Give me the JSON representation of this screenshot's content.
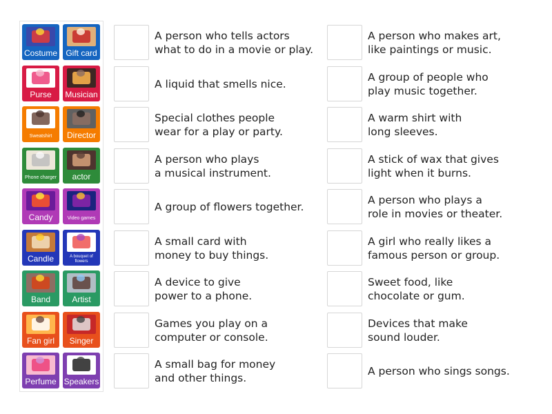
{
  "tiles": [
    {
      "label": "Costume",
      "color": "#1565c0",
      "pic": [
        "#3949ab",
        "#e53935",
        "#fdd835"
      ]
    },
    {
      "label": "Gift card",
      "color": "#1565c0",
      "pic": [
        "#e0b07a",
        "#c62828",
        "#fff3e0"
      ]
    },
    {
      "label": "Purse",
      "color": "#d81b45",
      "pic": [
        "#ffffff",
        "#ec407a",
        "#f8bbd0"
      ]
    },
    {
      "label": "Musician",
      "color": "#d81b45",
      "pic": [
        "#3e2723",
        "#ffb74d",
        "#8d6e63"
      ]
    },
    {
      "label": "Sweatshirt",
      "color": "#f57c00",
      "pic": [
        "#ffffff",
        "#6d4c41",
        "#4e342e"
      ],
      "small": true
    },
    {
      "label": "Director",
      "color": "#f57c00",
      "pic": [
        "#616161",
        "#8d6e63",
        "#212121"
      ]
    },
    {
      "label": "Phone charger",
      "color": "#2e8b3a",
      "pic": [
        "#ede7d9",
        "#bdbdbd",
        "#fafafa"
      ],
      "small": true
    },
    {
      "label": "actor",
      "color": "#2e8b3a",
      "pic": [
        "#4e342e",
        "#d7a27a",
        "#5d4037"
      ]
    },
    {
      "label": "Candy",
      "color": "#b03ab6",
      "pic": [
        "#6a1b9a",
        "#ff5722",
        "#ffeb3b"
      ]
    },
    {
      "label": "Video games",
      "color": "#b03ab6",
      "pic": [
        "#1a237e",
        "#8e24aa",
        "#fbc02d"
      ],
      "small": true
    },
    {
      "label": "Candle",
      "color": "#2337b8",
      "pic": [
        "#c47a3a",
        "#f5e1c0",
        "#ffca28"
      ]
    },
    {
      "label": "A bouquet of flowers",
      "color": "#2337b8",
      "pic": [
        "#ffffff",
        "#ef5350",
        "#ab47bc"
      ],
      "tiny": true
    },
    {
      "label": "Band",
      "color": "#2a9a63",
      "pic": [
        "#8d6e63",
        "#d84315",
        "#fdd835"
      ]
    },
    {
      "label": "Artist",
      "color": "#2a9a63",
      "pic": [
        "#b0bec5",
        "#5d4037",
        "#90caf9"
      ]
    },
    {
      "label": "Fan girl",
      "color": "#e8501c",
      "pic": [
        "#ffb74d",
        "#ffffff",
        "#6d4c41"
      ]
    },
    {
      "label": "Singer",
      "color": "#e8501c",
      "pic": [
        "#c62828",
        "#e0e0e0",
        "#424242"
      ]
    },
    {
      "label": "Perfume",
      "color": "#7e3fb0",
      "pic": [
        "#f8bbd0",
        "#ec407a",
        "#ce93d8"
      ]
    },
    {
      "label": "Speakers",
      "color": "#7e3fb0",
      "pic": [
        "#ffffff",
        "#212121",
        "#424242"
      ]
    }
  ],
  "clues_left": [
    "A person who tells actors\nwhat to do in a movie or play.",
    "A liquid that smells nice.",
    "Special clothes people\nwear for a play or party.",
    "A person who plays\na musical instrument.",
    "A group of flowers together.",
    "A small card with\nmoney to buy things.",
    "A device to give\npower to a phone.",
    "Games you play on a\ncomputer or console.",
    "A small bag for money\nand other things."
  ],
  "clues_right": [
    "A person who makes art,\nlike paintings or music.",
    "A group of people who\nplay music together.",
    "A warm shirt with\nlong sleeves.",
    "A stick of wax that gives\nlight when it burns.",
    "A person who plays a\nrole in movies or theater.",
    "A girl who really likes a\nfamous person or group.",
    "Sweet food, like\nchocolate or gum.",
    "Devices that make\nsound louder.",
    "A person who sings songs."
  ]
}
